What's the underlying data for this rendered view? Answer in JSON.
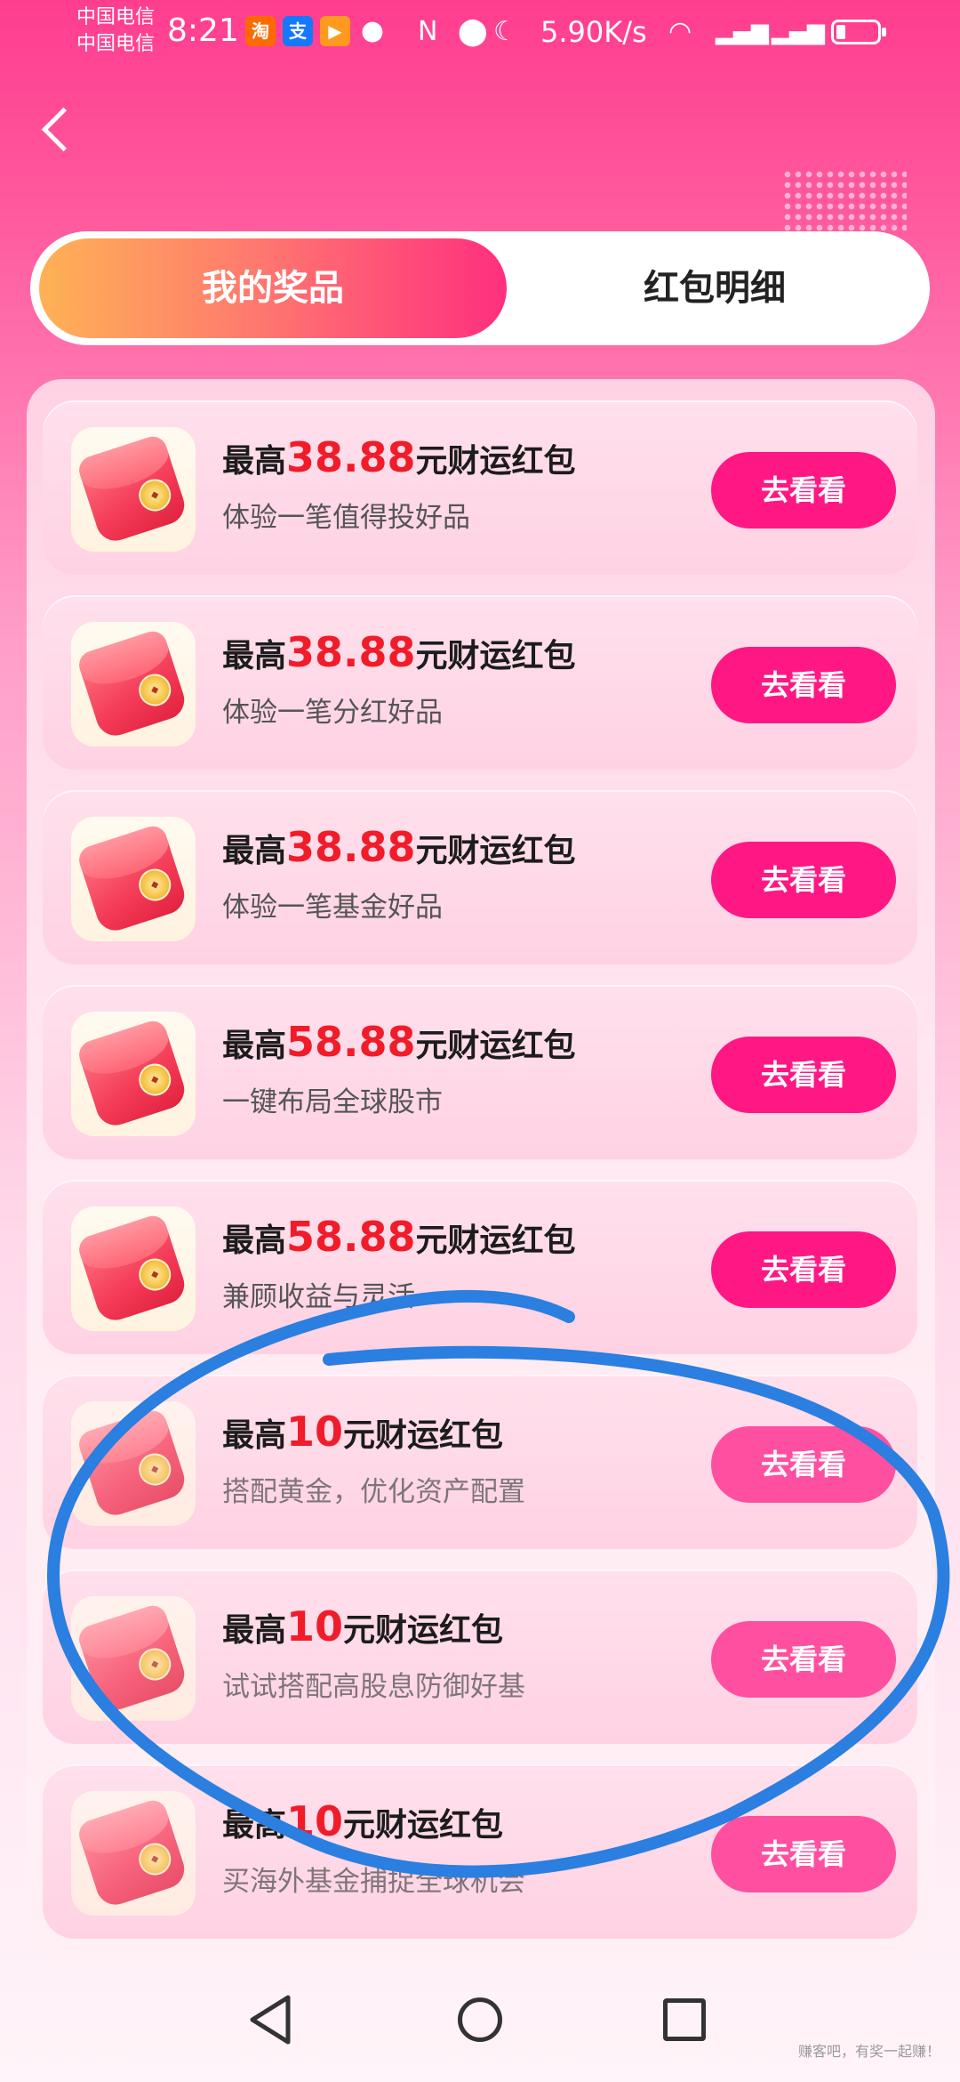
{
  "status_bar": {
    "carrier_1": "中国电信",
    "carrier_2": "中国电信",
    "time": "8:21",
    "net_speed": "5.90K/s",
    "app_icons": [
      "taobao-icon",
      "alipay-icon",
      "video-icon",
      "wechat-icon"
    ],
    "status_icons": [
      "nfc-icon",
      "location-icon",
      "moon-icon",
      "wifi-icon",
      "signal-4g-icon",
      "signal-4g-icon",
      "battery-icon"
    ],
    "battery_level": 0.2,
    "taobao_glyph": "淘",
    "alipay_glyph": "支"
  },
  "header": {
    "back_icon": "chevron-left-icon"
  },
  "tabs": [
    {
      "label": "我的奖品",
      "active": true
    },
    {
      "label": "红包明细",
      "active": false
    }
  ],
  "rewards": [
    {
      "prefix": "最高",
      "amount": "38.88",
      "suffix": "元财运红包",
      "subtitle": "体验一笔值得投好品",
      "button": "去看看"
    },
    {
      "prefix": "最高",
      "amount": "38.88",
      "suffix": "元财运红包",
      "subtitle": "体验一笔分红好品",
      "button": "去看看"
    },
    {
      "prefix": "最高",
      "amount": "38.88",
      "suffix": "元财运红包",
      "subtitle": "体验一笔基金好品",
      "button": "去看看"
    },
    {
      "prefix": "最高",
      "amount": "58.88",
      "suffix": "元财运红包",
      "subtitle": "一键布局全球股市",
      "button": "去看看"
    },
    {
      "prefix": "最高",
      "amount": "58.88",
      "suffix": "元财运红包",
      "subtitle": "兼顾收益与灵活",
      "button": "去看看"
    },
    {
      "prefix": "最高",
      "amount": "10",
      "suffix": "元财运红包",
      "subtitle": "搭配黄金，优化资产配置",
      "button": "去看看"
    },
    {
      "prefix": "最高",
      "amount": "10",
      "suffix": "元财运红包",
      "subtitle": "试试搭配高股息防御好基",
      "button": "去看看"
    },
    {
      "prefix": "最高",
      "amount": "10",
      "suffix": "元财运红包",
      "subtitle": "买海外基金捕捉全球机会",
      "button": "去看看"
    }
  ],
  "colors": {
    "accent": "#ff1784",
    "amount": "#f01c2a",
    "annotation": "#2a7fe0"
  },
  "nav_bar": {
    "icons": [
      "nav-back-icon",
      "nav-home-icon",
      "nav-recent-icon"
    ]
  },
  "watermark": "赚客吧，有奖一起赚！"
}
